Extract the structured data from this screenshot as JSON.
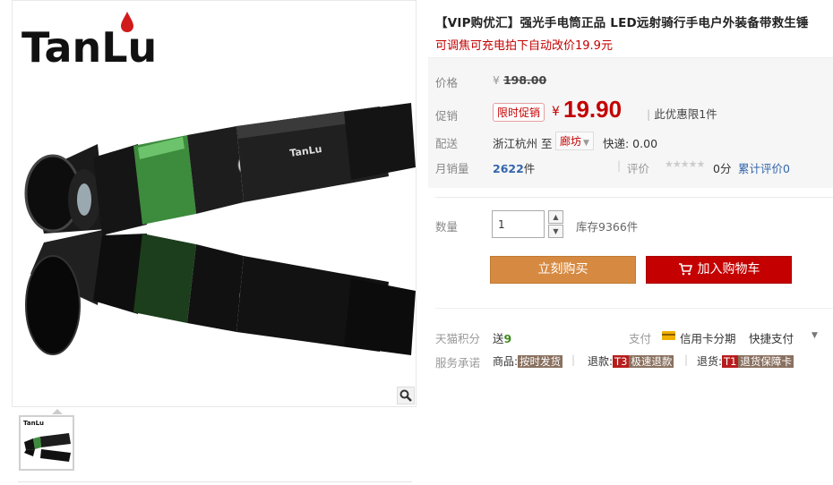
{
  "brand": {
    "logo_text": "TanLu"
  },
  "product": {
    "title": "【VIP购优汇】强光手电筒正品 LED远射骑行手电户外装备带救生锤",
    "subtitle": "可调焦可充电拍下自动改价19.9元"
  },
  "price": {
    "label": "价格",
    "currency": "¥",
    "original": "198.00",
    "promo_label": "促销",
    "promo_badge": "限时促销",
    "promo_price": "19.90",
    "promo_limit": "此优惠限1件"
  },
  "shipping": {
    "label": "配送",
    "from": "浙江杭州",
    "to_word": "至",
    "destination": "廊坊",
    "fee": "快递: 0.00"
  },
  "sales": {
    "label": "月销量",
    "count": "2622",
    "unit": "件",
    "rating_label": "评价",
    "stars": "★★★★★",
    "rating_value": "0分",
    "rating_count_label": "累计评价",
    "rating_count": "0"
  },
  "quantity": {
    "label": "数量",
    "value": "1",
    "inc": "▲",
    "dec": "▼",
    "stock": "库存9366件"
  },
  "actions": {
    "buy_now": "立刻购买",
    "add_to_cart": "加入购物车"
  },
  "points": {
    "label": "天猫积分",
    "give": "送",
    "value": "9"
  },
  "payment": {
    "label": "支付",
    "credit": "信用卡分期",
    "quick": "快捷支付",
    "caret": "▼"
  },
  "service": {
    "label": "服务承诺",
    "item1_prefix": "商品:",
    "item1_tag": "按时发货",
    "item2_prefix": "退款:",
    "item2_code": "T3",
    "item2_tag": "极速退款",
    "item3_prefix": "退货:",
    "item3_code": "T1",
    "item3_tag": "退货保障卡"
  },
  "colors": {
    "accent_red": "#c40000",
    "buy_orange": "#d68a41",
    "flashlight_green": "#4caf50"
  }
}
